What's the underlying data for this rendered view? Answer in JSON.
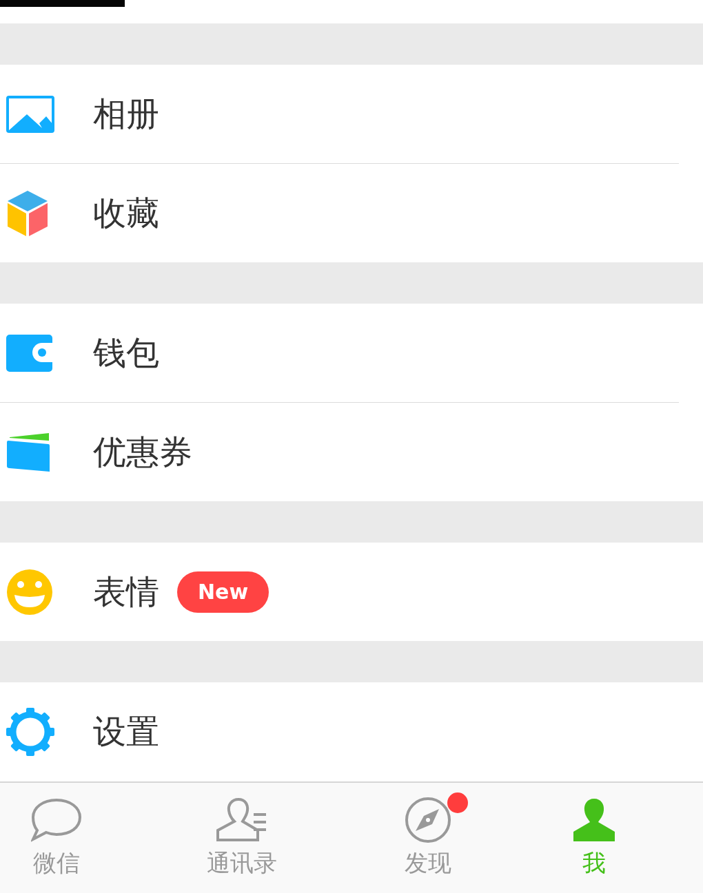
{
  "groups": [
    {
      "items": [
        {
          "label": "相册"
        },
        {
          "label": "收藏"
        }
      ]
    },
    {
      "items": [
        {
          "label": "钱包"
        },
        {
          "label": "优惠券"
        }
      ]
    },
    {
      "items": [
        {
          "label": "表情",
          "badge": "New"
        }
      ]
    },
    {
      "items": [
        {
          "label": "设置"
        }
      ]
    }
  ],
  "tabs": [
    {
      "label": "微信",
      "selected": false,
      "dot": false
    },
    {
      "label": "通讯录",
      "selected": false,
      "dot": false
    },
    {
      "label": "发现",
      "selected": false,
      "dot": true
    },
    {
      "label": "我",
      "selected": true,
      "dot": false
    }
  ]
}
